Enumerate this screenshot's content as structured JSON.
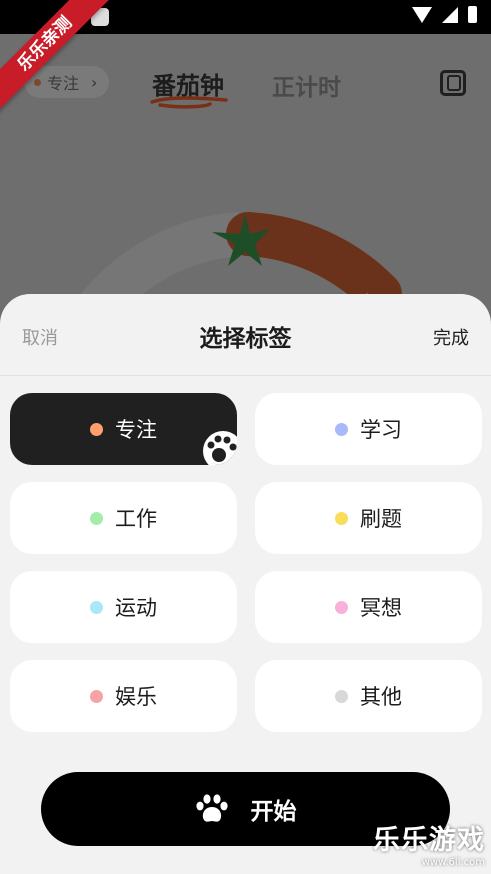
{
  "watermark_badge": "乐乐亲测",
  "header": {
    "focus_chip": "专注",
    "tab_pomodoro": "番茄钟",
    "tab_countup": "正计时"
  },
  "sheet": {
    "cancel": "取消",
    "title": "选择标签",
    "done": "完成",
    "tags": [
      {
        "label": "专注",
        "color": "#ff9f6e",
        "selected": true
      },
      {
        "label": "学习",
        "color": "#a9b8f8",
        "selected": false
      },
      {
        "label": "工作",
        "color": "#a3ecac",
        "selected": false
      },
      {
        "label": "刷题",
        "color": "#f9dd5a",
        "selected": false
      },
      {
        "label": "运动",
        "color": "#a8e8f8",
        "selected": false
      },
      {
        "label": "冥想",
        "color": "#f9b0da",
        "selected": false
      },
      {
        "label": "娱乐",
        "color": "#f5a3a3",
        "selected": false
      },
      {
        "label": "其他",
        "color": "#d8d8d8",
        "selected": false
      }
    ],
    "start": "开始"
  },
  "brand_watermark": {
    "main": "乐乐游戏",
    "sub": "www.6ll.com"
  }
}
